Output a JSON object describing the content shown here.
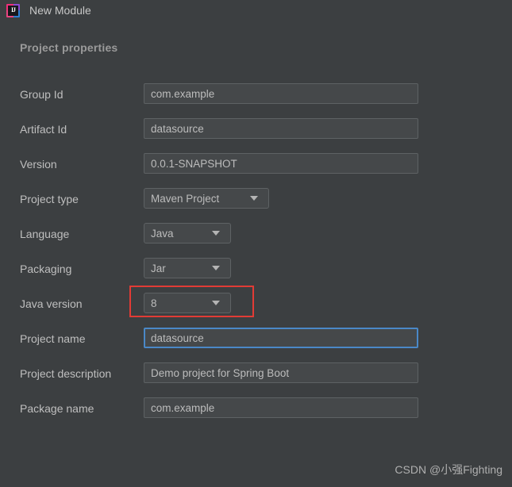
{
  "window": {
    "title": "New Module",
    "icon": "intellij-idea-icon"
  },
  "section": {
    "header": "Project properties"
  },
  "colors": {
    "background": "#3c3f41",
    "field_background": "#45484a",
    "field_border": "#5e6264",
    "label_text": "#bfbfbf",
    "focus_border": "#4a88c7",
    "annotation_red": "#e23b35"
  },
  "form": {
    "rows": [
      {
        "label": "Group Id",
        "value": "com.example",
        "type": "text",
        "width": "wide"
      },
      {
        "label": "Artifact Id",
        "value": "datasource",
        "type": "text",
        "width": "wide"
      },
      {
        "label": "Version",
        "value": "0.0.1-SNAPSHOT",
        "type": "text",
        "width": "wide"
      },
      {
        "label": "Project type",
        "value": "Maven Project",
        "type": "combo",
        "width": "w-project-type"
      },
      {
        "label": "Language",
        "value": "Java",
        "type": "combo",
        "width": "w-small"
      },
      {
        "label": "Packaging",
        "value": "Jar",
        "type": "combo",
        "width": "w-small"
      },
      {
        "label": "Java version",
        "value": "8",
        "type": "combo",
        "width": "w-small",
        "annotated": true
      },
      {
        "label": "Project name",
        "value": "datasource",
        "type": "text",
        "width": "wide",
        "focused": true
      },
      {
        "label": "Project description",
        "value": "Demo project for Spring Boot",
        "type": "text",
        "width": "wide"
      },
      {
        "label": "Package name",
        "value": "com.example",
        "type": "text",
        "width": "wide"
      }
    ]
  },
  "watermark": {
    "text": "CSDN @小强Fighting"
  }
}
